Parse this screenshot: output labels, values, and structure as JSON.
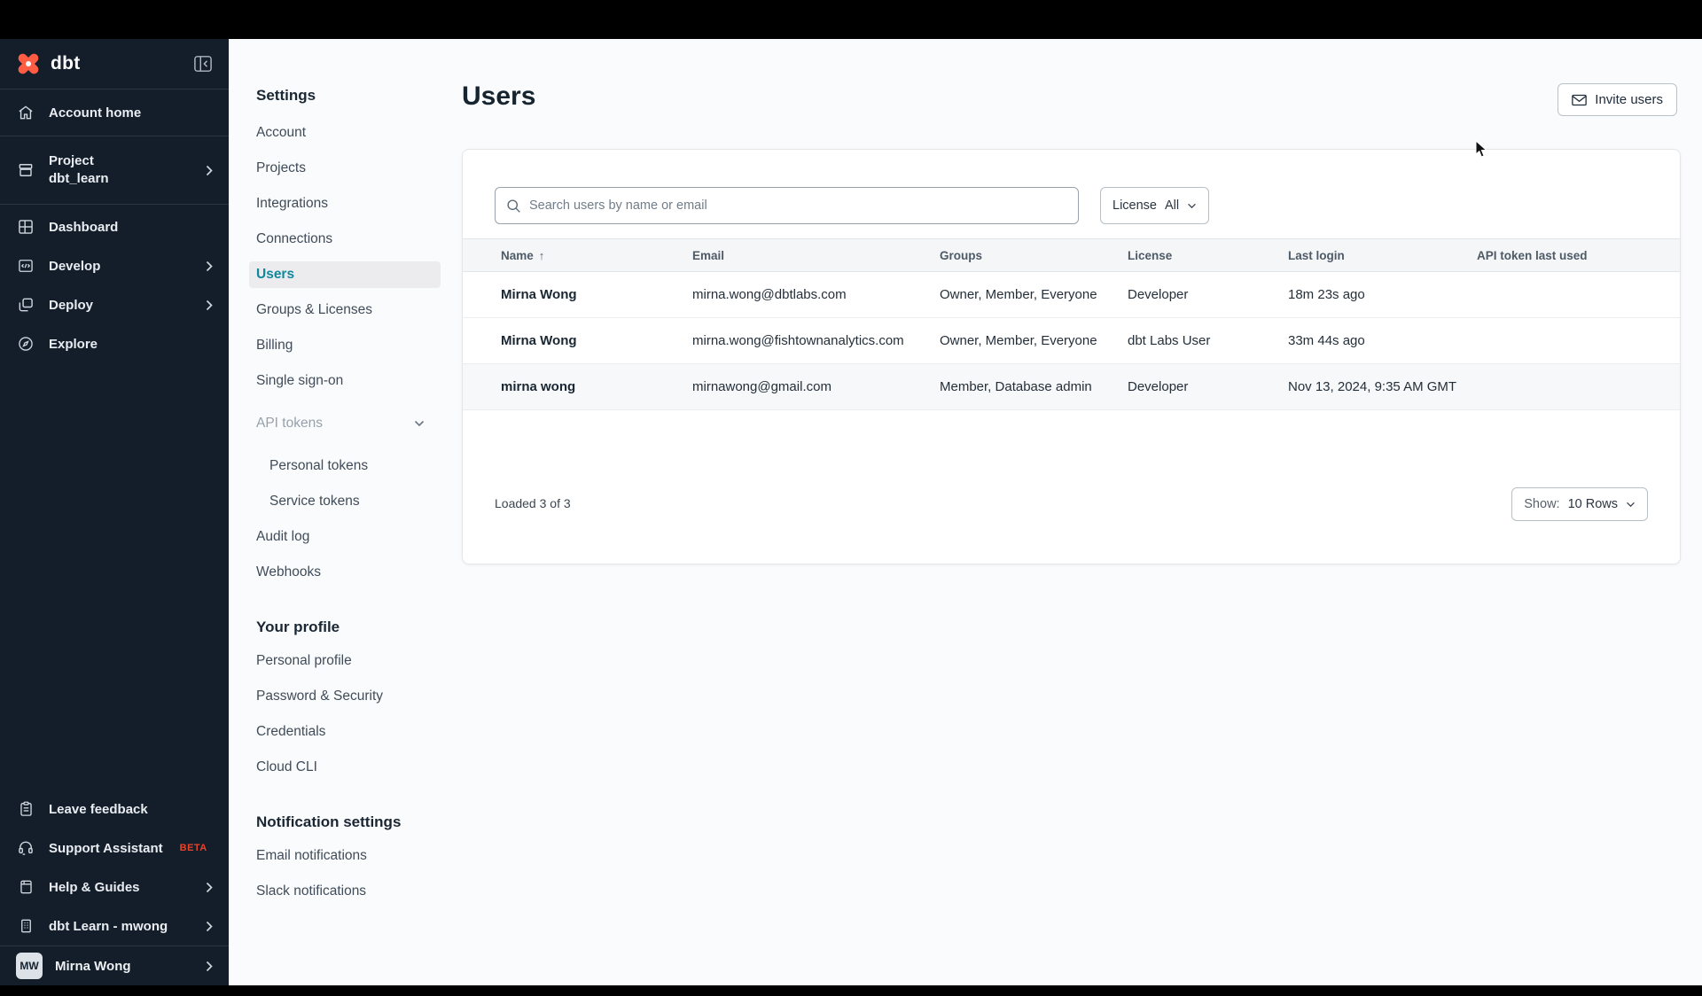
{
  "sidebar": {
    "brand": "dbt",
    "items": [
      {
        "label": "Account home"
      },
      {
        "label": "Project",
        "sublabel": "dbt_learn"
      },
      {
        "label": "Dashboard"
      },
      {
        "label": "Develop"
      },
      {
        "label": "Deploy"
      },
      {
        "label": "Explore"
      }
    ],
    "footer_items": [
      {
        "label": "Leave feedback"
      },
      {
        "label": "Support Assistant",
        "badge": "BETA"
      },
      {
        "label": "Help & Guides"
      },
      {
        "label": "dbt Learn - mwong"
      }
    ],
    "user": {
      "initials": "MW",
      "name": "Mirna Wong"
    }
  },
  "settings_nav": {
    "heading": "Settings",
    "items": {
      "account": "Account",
      "projects": "Projects",
      "integrations": "Integrations",
      "connections": "Connections",
      "users": "Users",
      "groups_licenses": "Groups & Licenses",
      "billing": "Billing",
      "sso": "Single sign-on",
      "api_tokens": "API tokens",
      "personal_tokens": "Personal tokens",
      "service_tokens": "Service tokens",
      "audit_log": "Audit log",
      "webhooks": "Webhooks"
    },
    "profile_heading": "Your profile",
    "profile_items": {
      "personal_profile": "Personal profile",
      "password_security": "Password & Security",
      "credentials": "Credentials",
      "cloud_cli": "Cloud CLI"
    },
    "notifications_heading": "Notification settings",
    "notification_items": {
      "email": "Email notifications",
      "slack": "Slack notifications"
    },
    "active_item": "Users"
  },
  "main": {
    "title": "Users",
    "invite_button": "Invite users",
    "search_placeholder": "Search users by name or email",
    "license_filter": {
      "label": "License",
      "value": "All"
    },
    "table": {
      "columns": [
        "Name",
        "Email",
        "Groups",
        "License",
        "Last login",
        "API token last used"
      ],
      "rows": [
        {
          "name": "Mirna Wong",
          "email": "mirna.wong@dbtlabs.com",
          "groups": "Owner, Member, Everyone",
          "license": "Developer",
          "last_login": "18m 23s ago",
          "api_token_last_used": ""
        },
        {
          "name": "Mirna Wong",
          "email": "mirna.wong@fishtownanalytics.com",
          "groups": "Owner, Member, Everyone",
          "license": "dbt Labs User",
          "last_login": "33m 44s ago",
          "api_token_last_used": ""
        },
        {
          "name": "mirna wong",
          "email": "mirnawong@gmail.com",
          "groups": "Member, Database admin",
          "license": "Developer",
          "last_login": "Nov 13, 2024, 9:35 AM GMT",
          "api_token_last_used": ""
        }
      ],
      "status": "Loaded 3 of 3",
      "show_label": "Show:",
      "show_value": "10 Rows"
    }
  },
  "icons": {
    "sort_ascending": "↑"
  },
  "colors": {
    "sidebar_bg": "#141e2b",
    "brand_orange": "#ff5c44",
    "beta_orange": "#e8432a",
    "accent_teal": "#12899a",
    "page_bg": "#fafbfc"
  }
}
